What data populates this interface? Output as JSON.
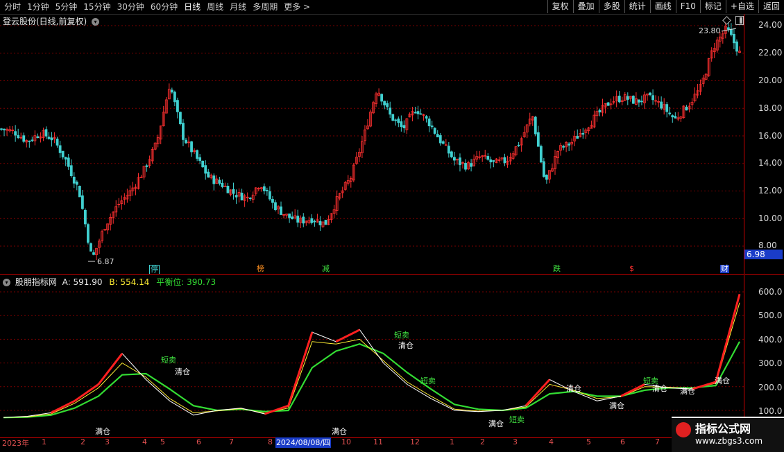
{
  "toolbar": {
    "periods": [
      "分时",
      "1分钟",
      "5分钟",
      "15分钟",
      "30分钟",
      "60分钟",
      "日线",
      "周线",
      "月线",
      "多周期",
      "更多 >"
    ],
    "active_period": "日线",
    "actions": [
      "复权",
      "叠加",
      "多股",
      "统计",
      "画线",
      "F10",
      "标记",
      "+自选",
      "返回"
    ]
  },
  "main": {
    "title": "登云股份(日线,前复权)",
    "high_label": "23.80",
    "low_label": "6.87",
    "price_badge": "6.98",
    "price_axis": [
      "24.00",
      "22.00",
      "20.00",
      "18.00",
      "16.00",
      "14.00",
      "12.00",
      "10.00",
      "8.00"
    ],
    "events": [
      "停",
      "榜",
      "减",
      "跌",
      "$",
      "财"
    ]
  },
  "indicator": {
    "name": "股朋指标网",
    "a_label": "A: 591.90",
    "b_label": "B: 554.14",
    "balance_label": "平衡位: 390.73",
    "axis": [
      "600.0",
      "500.0",
      "400.0",
      "300.0",
      "200.0",
      "100.0"
    ],
    "signals": [
      "短卖",
      "清仓",
      "满仓"
    ]
  },
  "date_axis": {
    "labels": [
      "2023年",
      "1",
      "2",
      "3",
      "4",
      "5",
      "6",
      "7",
      "8",
      "10",
      "11",
      "12",
      "1",
      "2",
      "3",
      "4",
      "5",
      "6",
      "7"
    ],
    "cursor": "2024/08/08/四"
  },
  "watermark": {
    "title": "指标公式网",
    "url": "www.zbgs3.com"
  },
  "colors": {
    "up": "#ff3030",
    "down": "#40d0d0",
    "line_a": "#ffffff",
    "line_b": "#ffee33",
    "balance": "#33dd33",
    "hot": "#ff2020"
  },
  "chart_data": {
    "type": "candlestick",
    "ylim": [
      8,
      24
    ],
    "price_path": [
      16.5,
      16.3,
      15.6,
      16.2,
      15.8,
      14.2,
      12.0,
      7.0,
      9.5,
      11.0,
      12.0,
      13.5,
      15.5,
      19.8,
      16.0,
      14.5,
      13.0,
      12.5,
      11.8,
      11.5,
      12.6,
      11.0,
      10.2,
      9.8,
      10.0,
      9.6,
      11.5,
      13.0,
      16.0,
      19.5,
      17.5,
      16.5,
      18.0,
      17.0,
      15.5,
      14.2,
      13.8,
      14.5,
      14.0,
      14.2,
      15.5,
      17.5,
      12.5,
      15.0,
      15.5,
      16.5,
      17.5,
      18.5,
      18.8,
      18.5,
      18.8,
      18.2,
      17.2,
      18.2,
      19.5,
      22.5,
      23.8,
      22.0
    ],
    "high": 23.8,
    "low": 6.87,
    "indicator": {
      "ylim": [
        50,
        650
      ],
      "series": [
        {
          "name": "A",
          "values": [
            70,
            75,
            90,
            140,
            210,
            340,
            230,
            140,
            80,
            100,
            110,
            85,
            120,
            430,
            390,
            440,
            300,
            210,
            150,
            100,
            95,
            100,
            120,
            230,
            180,
            140,
            160,
            210,
            195,
            190,
            220,
            590
          ]
        },
        {
          "name": "B",
          "values": [
            70,
            73,
            85,
            130,
            195,
            300,
            240,
            150,
            90,
            98,
            108,
            88,
            110,
            390,
            380,
            400,
            310,
            220,
            160,
            105,
            97,
            100,
            115,
            210,
            185,
            150,
            158,
            200,
            198,
            190,
            215,
            554
          ]
        },
        {
          "name": "平衡位",
          "values": [
            70,
            72,
            80,
            110,
            160,
            250,
            255,
            190,
            120,
            100,
            105,
            95,
            100,
            280,
            350,
            380,
            340,
            260,
            190,
            125,
            105,
            100,
            110,
            170,
            180,
            160,
            160,
            185,
            195,
            195,
            205,
            390
          ]
        }
      ]
    }
  }
}
